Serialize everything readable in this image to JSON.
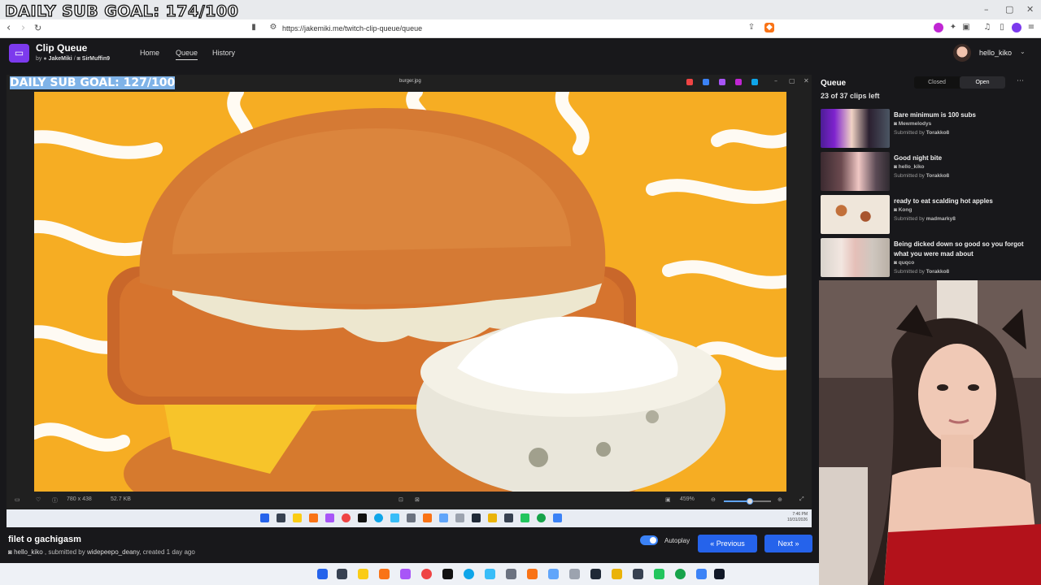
{
  "overlay": {
    "goal_text": "DAILY SUB GOAL: 174/100"
  },
  "browser": {
    "url": "https://jakemiki.me/twitch-clip-queue/queue",
    "window_controls": {
      "minimize": "–",
      "maximize": "▢",
      "close": "✕"
    }
  },
  "app": {
    "title": "Clip Queue",
    "by_prefix": "by",
    "author1": "JakeMiki",
    "separator": "/",
    "author2": "SirMuffin9",
    "nav": [
      {
        "label": "Home"
      },
      {
        "label": "Queue"
      },
      {
        "label": "History"
      }
    ],
    "user": "hello_kiko"
  },
  "player": {
    "stream_goal_text": "DAILY SUB GOAL: 127/100",
    "window_title": "burger.jpg",
    "image_size": "780 x 438",
    "file_size": "52.7 KB",
    "zoom": "459%",
    "zoom_level": 0.55,
    "clock_time": "7:46 PM",
    "clock_date": "10/31/2026"
  },
  "clip": {
    "title": "filet o gachigasm",
    "channel": "hello_kiko",
    "submitted_by_label": ", submitted by",
    "submitter": "widepeepo_deany",
    "created": ", created 1 day ago",
    "autoplay_label": "Autoplay",
    "autoplay_on": true,
    "previous_label": "Previous",
    "next_label": "Next"
  },
  "queue": {
    "title": "Queue",
    "closed_label": "Closed",
    "open_label": "Open",
    "count_text": "23 of 37 clips left",
    "submitted_by_label": "Submitted by",
    "items": [
      {
        "title": "Bare minimum is 100 subs",
        "channel": "Mewmelodys",
        "submitter": "Torakko8"
      },
      {
        "title": "Good night bite",
        "channel": "hello_kiko",
        "submitter": "Torakko8"
      },
      {
        "title": "ready to eat scalding hot apples",
        "channel": "Kong",
        "submitter": "madmarky8"
      },
      {
        "title": "Being dicked down so good so you forgot what you were mad about",
        "channel": "quqco",
        "submitter": "Torakko8"
      }
    ]
  },
  "colors": {
    "accent": "#2563eb",
    "brand": "#7c3aed",
    "burger_bg": "#f6ad23"
  }
}
